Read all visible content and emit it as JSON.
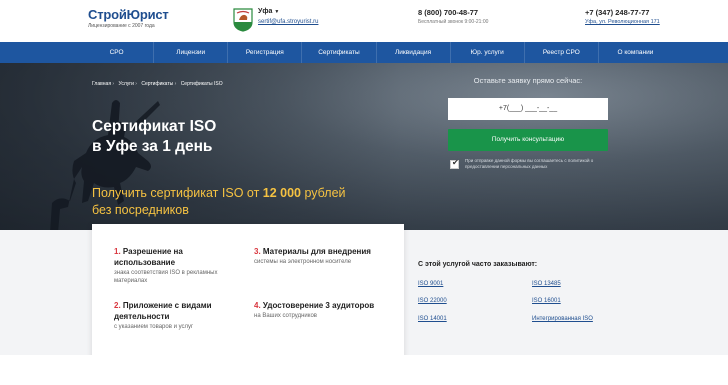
{
  "header": {
    "brand": "СтройЮрист",
    "tagline": "Лицензирование с 2007 года",
    "city": "Уфа",
    "email": "sertif@ufa.stroyurist.ru",
    "phone1": "8 (800) 700-48-77",
    "phone1_note": "Бесплатный звонок 9:00-21:00",
    "phone2": "+7 (347) 248-77-77",
    "address": "Уфа, ул. Революционная 171"
  },
  "nav": {
    "items": [
      "СРО",
      "Лицензии",
      "Регистрация",
      "Сертификаты",
      "Ликвидация",
      "Юр. услуги",
      "Реестр СРО",
      "О компании"
    ]
  },
  "breadcrumbs": [
    "Главная",
    "Услуги",
    "Сертификаты",
    "Сертификаты ISO"
  ],
  "hero": {
    "title_line1": "Сертификат ISO",
    "title_line2": "в Уфе за 1 день",
    "subtitle_prefix": "Получить сертификат ISO от ",
    "subtitle_price": "12 000",
    "subtitle_suffix": " рублей",
    "subtitle_line2": "без посредников"
  },
  "form": {
    "title": "Оставьте заявку прямо сейчас:",
    "phone_placeholder": "+7(___) ___-__-__",
    "submit_label": "Получить консультацию",
    "consent_text": "При отправке данной формы вы соглашаетесь с политикой о предоставлении персональных данных"
  },
  "features": [
    {
      "num": "1.",
      "title": "Разрешение на использование",
      "desc": "знака соответствия ISO в рекламных материалах"
    },
    {
      "num": "3.",
      "title": "Материалы для внедрения",
      "desc": "системы на электронном носителе"
    },
    {
      "num": "2.",
      "title": "Приложение с видами деятельности",
      "desc": "с указанием товаров и услуг"
    },
    {
      "num": "4.",
      "title": "Удостоверение 3 аудиторов",
      "desc": "на Ваших сотрудников"
    }
  ],
  "related": {
    "title": "С этой услугой часто заказывают:",
    "links": [
      "ISO 9001",
      "ISO 13485",
      "ISO 22000",
      "ISO 16001",
      "ISO 14001",
      "Интегрированная ISO"
    ]
  },
  "colors": {
    "brand_blue": "#1e56a0",
    "accent_green": "#19944a",
    "price_yellow": "#f5c242",
    "number_red": "#d9363e"
  }
}
